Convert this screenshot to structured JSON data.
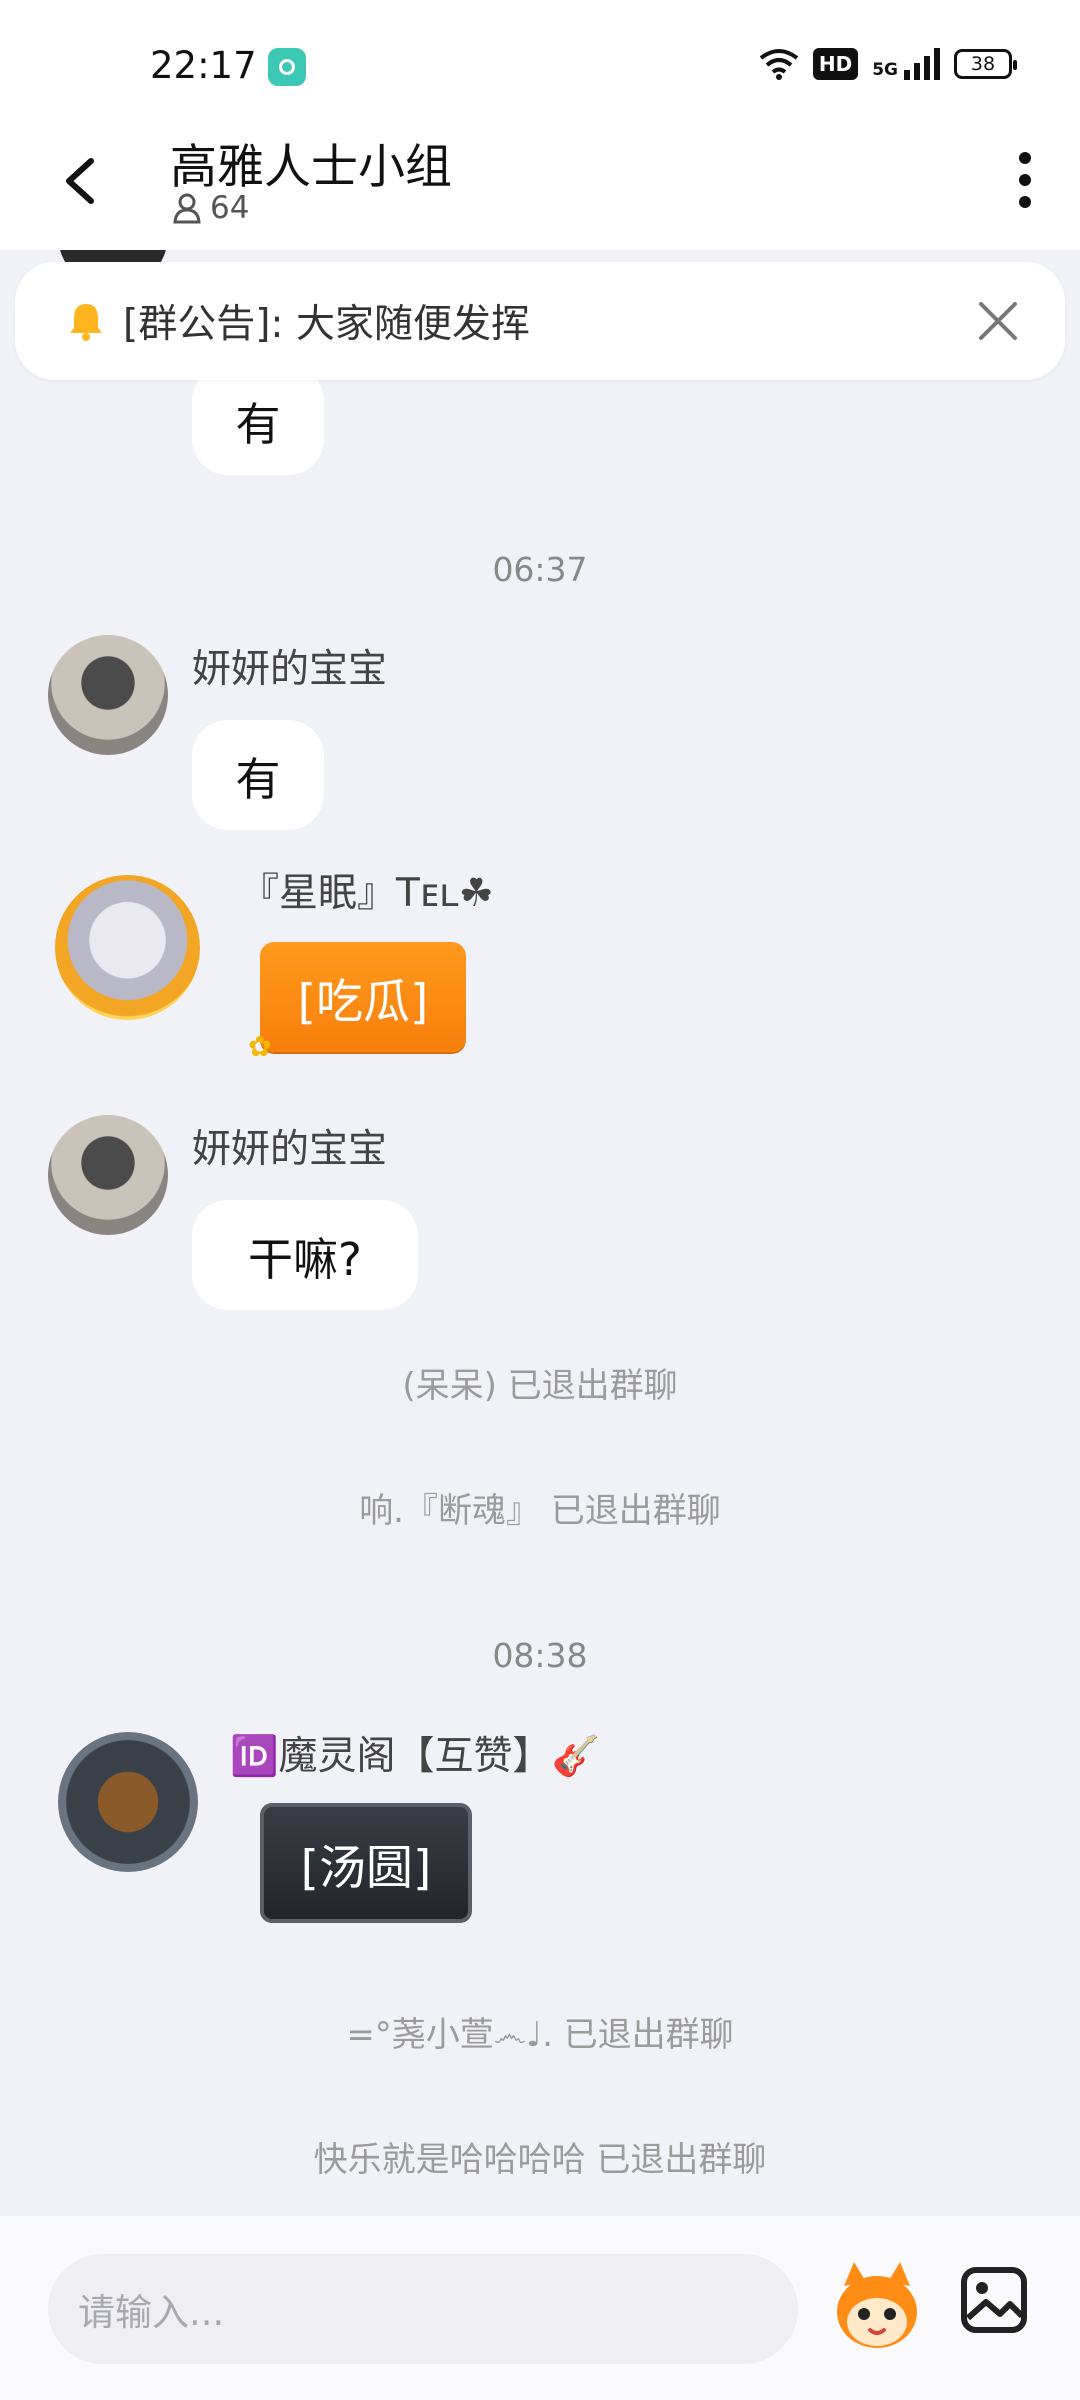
{
  "status": {
    "time": "22:17",
    "hd": "HD",
    "signal": "5G",
    "battery": "38"
  },
  "header": {
    "title": "高雅人士小组",
    "member_count": "64"
  },
  "notice": {
    "text": "[群公告]: 大家随便发挥"
  },
  "messages": [
    {
      "text": "有"
    },
    {
      "time": "06:37"
    },
    {
      "sender": "妍妍的宝宝",
      "text": "有"
    },
    {
      "sender": "『星眠』Tᴇʟ☘",
      "sticker": "[吃瓜]"
    },
    {
      "sender": "妍妍的宝宝",
      "text": "干嘛?"
    },
    {
      "system": "(呆呆) 已退出群聊"
    },
    {
      "system": "响.『断魂』 已退出群聊"
    },
    {
      "time": "08:38"
    },
    {
      "sender": "🆔魔灵阁【互赞】🎸",
      "sticker": "[汤圆]"
    },
    {
      "system": "=°荛小萱෴♩. 已退出群聊"
    },
    {
      "system": "快乐就是哈哈哈哈 已退出群聊"
    }
  ],
  "input": {
    "placeholder": "请输入..."
  },
  "colors": {
    "sticker_orange": "#ff8c14",
    "background": "#f1f2f8"
  }
}
